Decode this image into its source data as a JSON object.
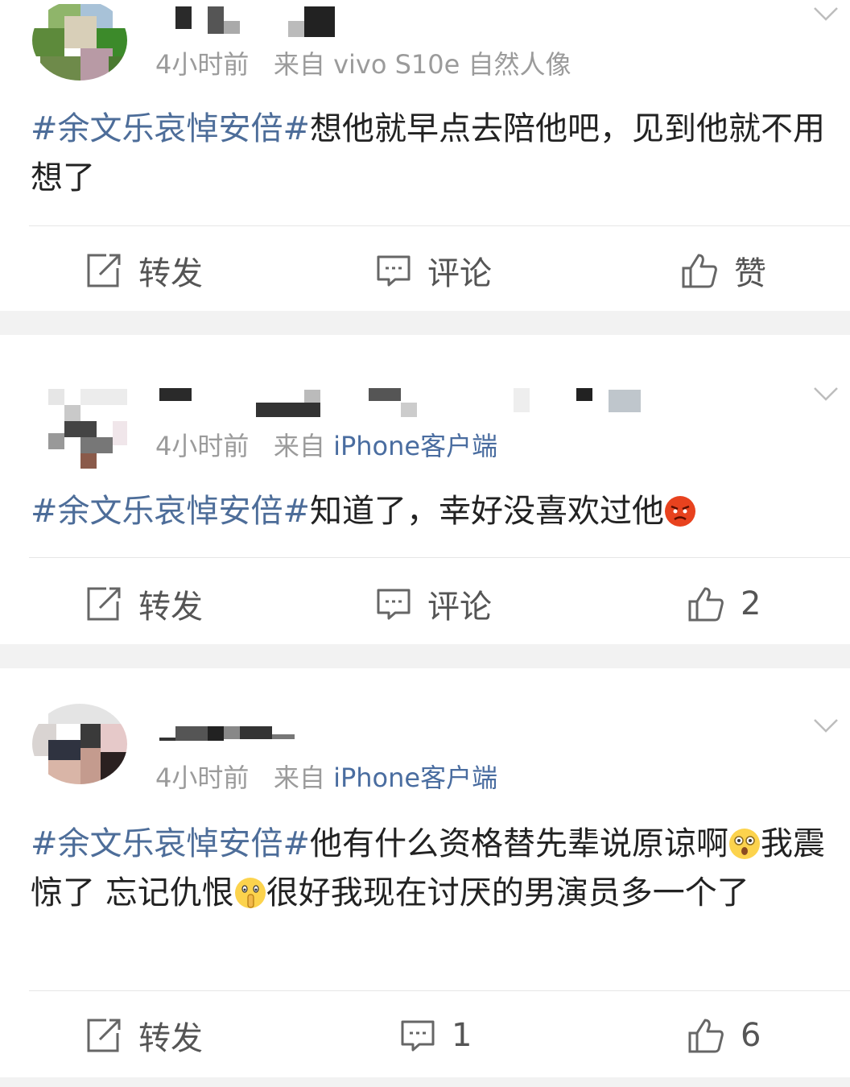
{
  "posts": [
    {
      "time": "4小时前",
      "source_prefix": "来自",
      "source": "vivo S10e 自然人像",
      "hashtag": "#余文乐哀悼安倍#",
      "text": "想他就早点去陪他吧，见到他就不用想了",
      "actions": {
        "repost": "转发",
        "comment": "评论",
        "like": "赞"
      }
    },
    {
      "time": "4小时前",
      "source_prefix": "来自",
      "source": "iPhone客户端",
      "hashtag": "#余文乐哀悼安倍#",
      "text": "知道了，幸好没喜欢过他",
      "emoji": "angry-face",
      "actions": {
        "repost": "转发",
        "comment": "评论",
        "like": "2"
      }
    },
    {
      "time": "4小时前",
      "source_prefix": "来自",
      "source": "iPhone客户端",
      "hashtag": "#余文乐哀悼安倍#",
      "text_part1": "他有什么资格替先辈说原谅啊",
      "emoji1": "astonished-face",
      "text_part2": "我震惊了 忘记仇恨",
      "emoji2": "shush-face",
      "text_part3": "很好我现在讨厌的男演员多一个了",
      "actions": {
        "repost": "转发",
        "comment": "1",
        "like": "6"
      }
    }
  ],
  "colors": {
    "link": "#4d6d99",
    "meta": "#9b9b9b",
    "background": "#f2f2f2"
  }
}
